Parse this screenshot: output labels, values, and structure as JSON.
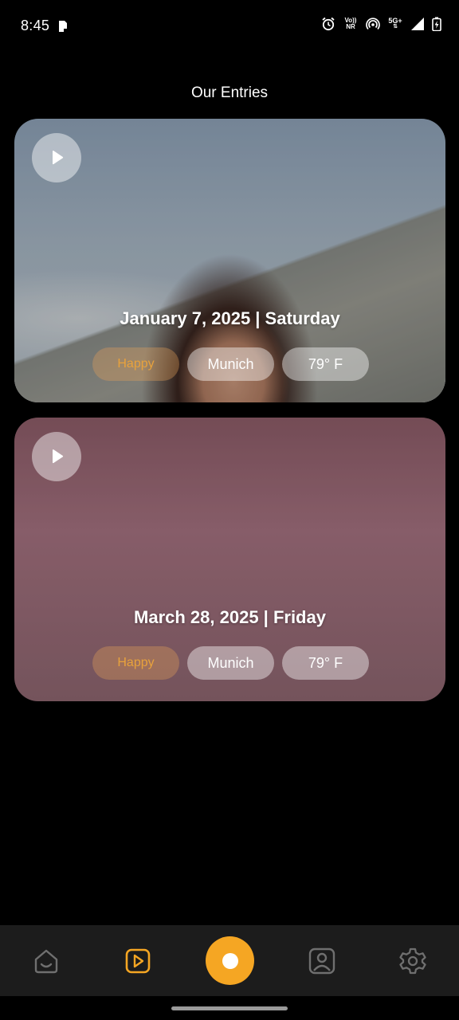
{
  "status_bar": {
    "time": "8:45",
    "icons": [
      "notification-icon",
      "alarm-icon",
      "vonr-icon",
      "hotspot-icon",
      "5g-plus-icon",
      "signal-icon",
      "battery-icon"
    ],
    "vonr_text_top": "Vo))",
    "vonr_text_bottom": "NR",
    "network_text": "5G+"
  },
  "page": {
    "title": "Our Entries"
  },
  "entries": [
    {
      "date_label": "January 7, 2025 | Saturday",
      "mood": "Happy",
      "city": "Munich",
      "temperature": "79° F"
    },
    {
      "date_label": "March 28, 2025 | Friday",
      "mood": "Happy",
      "city": "Munich",
      "temperature": "79° F"
    }
  ],
  "bottom_nav": {
    "items": [
      {
        "icon": "home-icon",
        "active": false
      },
      {
        "icon": "video-play-icon",
        "active": true
      },
      {
        "icon": "record-icon",
        "active": false
      },
      {
        "icon": "profile-icon",
        "active": false
      },
      {
        "icon": "settings-icon",
        "active": false
      }
    ]
  },
  "colors": {
    "background": "#000000",
    "accent": "#f5a623",
    "nav_background": "#1c1c1c",
    "nav_icon_inactive": "#6f6f6f",
    "mood_chip_text": "#e8a23c"
  }
}
